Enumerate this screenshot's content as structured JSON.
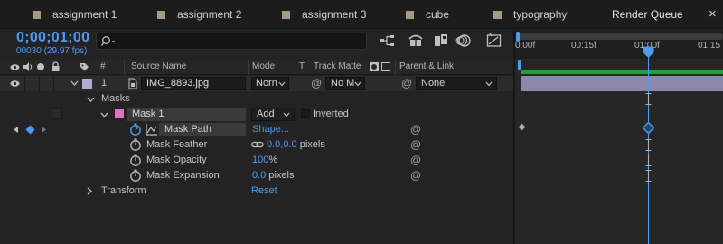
{
  "tabs": [
    {
      "label": "assignment 1"
    },
    {
      "label": "assignment 2"
    },
    {
      "label": "assignment 3"
    },
    {
      "label": "cube"
    },
    {
      "label": "typography"
    },
    {
      "label": "Render Queue"
    }
  ],
  "close_label": "×",
  "toolbar": {
    "timecode": "0;00;01;00",
    "fps": "00030 (29.97 fps)",
    "search_value": ""
  },
  "columns": {
    "number": "#",
    "source_name": "Source Name",
    "mode": "Mode",
    "t": "T",
    "track_matte": "Track Matte",
    "parent": "Parent & Link"
  },
  "layer": {
    "index": "1",
    "name": "IMG_8893.jpg",
    "mode": "Norn",
    "track_matte": "No M",
    "parent": "None"
  },
  "masks_group": "Masks",
  "mask": {
    "name": "Mask 1",
    "mode": "Add",
    "inverted_label": "Inverted"
  },
  "properties": [
    {
      "name": "Mask Path",
      "value": "Shape..."
    },
    {
      "name": "Mask Feather",
      "value": "0.0,0.0",
      "unit": " pixels"
    },
    {
      "name": "Mask Opacity",
      "value": "100",
      "unit": "%"
    },
    {
      "name": "Mask Expansion",
      "value": "0.0",
      "unit": " pixels"
    }
  ],
  "transform": {
    "label": "Transform",
    "reset_label": "Reset"
  },
  "timeline": {
    "ticks": [
      "0:00f",
      "00:15f",
      "01:00f",
      "01:15"
    ],
    "current_time_fraction": 0.5
  },
  "colors": {
    "accent": "#4d9cf0",
    "layer_label": "#b3a9d6",
    "mask_label": "#e26fc6",
    "work_area": "#1fa33a"
  }
}
